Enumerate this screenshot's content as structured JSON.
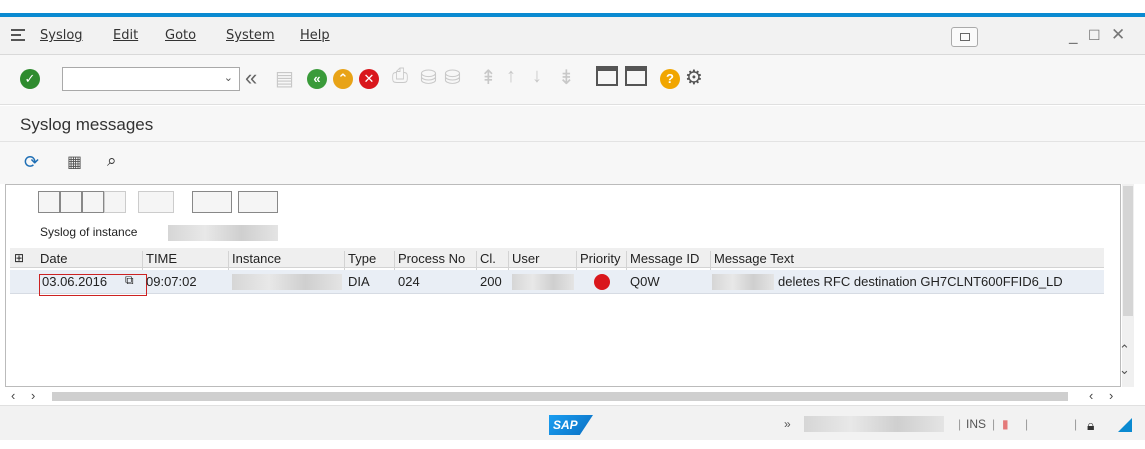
{
  "menu": {
    "items": [
      "Syslog",
      "Edit",
      "Goto",
      "System",
      "Help"
    ]
  },
  "toolbar": {
    "command_value": "",
    "icons": [
      "enter-icon",
      "back-icon",
      "save-icon",
      "exit-icon",
      "up-icon",
      "cancel-icon",
      "print-icon",
      "find-icon",
      "find-next-icon",
      "first-page-icon",
      "prev-page-icon",
      "next-page-icon",
      "last-page-icon",
      "create-session-icon",
      "shortcut-icon",
      "help-icon",
      "settings-icon"
    ]
  },
  "title": "Syslog messages",
  "alv": {
    "header_text": "Syslog of instance",
    "columns": [
      "Date",
      "TIME",
      "Instance",
      "Type",
      "Process No",
      "Cl.",
      "User",
      "Priority",
      "Message ID",
      "Message Text"
    ],
    "rows": [
      {
        "date": "03.06.2016",
        "time": "09:07:02",
        "instance": "",
        "type": "DIA",
        "process_no": "024",
        "client": "200",
        "user": "",
        "priority": "red",
        "message_id": "Q0W",
        "message_text": "deletes RFC destination GH7CLNT600FFID6_LD"
      }
    ]
  },
  "status": {
    "arrow": "»",
    "mode": "INS",
    "separator": "|"
  },
  "colors": {
    "accent": "#0a8ad1",
    "priority_red": "#d9171c"
  }
}
